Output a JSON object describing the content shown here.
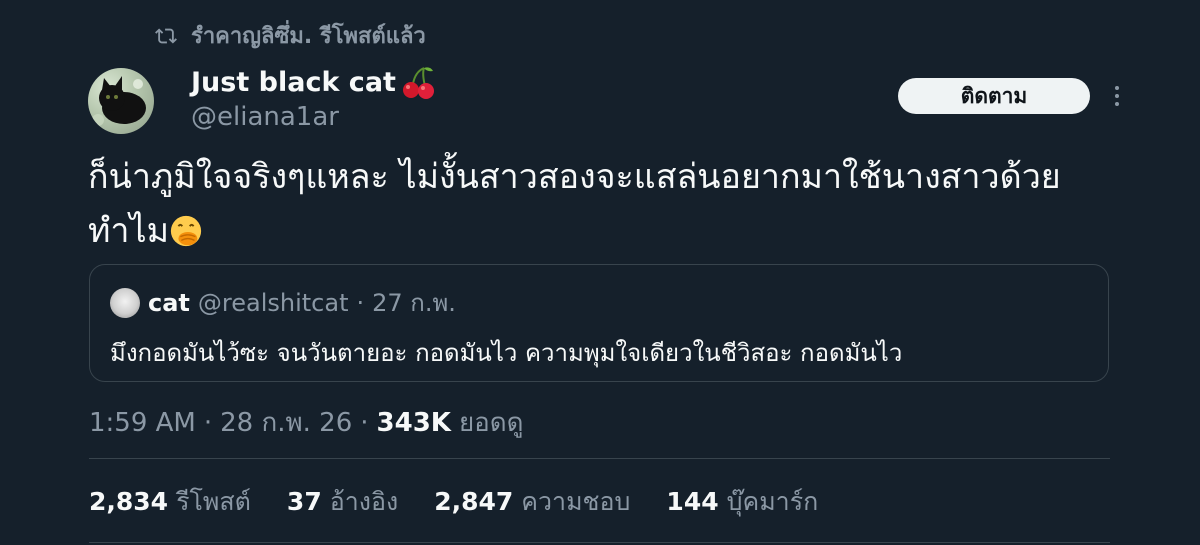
{
  "repost_header": {
    "text": "รำคาญลิซึ่ม. รีโพสต์แล้ว",
    "icon": "repost-icon"
  },
  "author": {
    "name": "Just black cat",
    "name_emoji": "cherry-icon",
    "handle": "@eliana1ar",
    "avatar": "black-cat-avatar"
  },
  "follow_label": "ติดตาม",
  "more_icon": "more-options-icon",
  "tweet": {
    "text": "ก็น่าภูมิใจจริงๆแหละ ไม่งั้นสาวสองจะแสล่นอยากมาใช้นางสาวด้วยทำไม",
    "emoji": "hand-over-mouth-emoji"
  },
  "quote": {
    "name": "cat",
    "handle": "@realshitcat",
    "separator": "·",
    "date": "27 ก.พ.",
    "text": "มึงกอดมันไว้ซะ จนวันตายอะ กอดมันไว ความพุมใจเดียวในชีวิสอะ กอดมันไว"
  },
  "meta": {
    "time": "1:59 AM",
    "sep1": "·",
    "date": "28 ก.พ. 26",
    "sep2": "·",
    "views_count": "343K",
    "views_label": "ยอดดู"
  },
  "stats": [
    {
      "count": "2,834",
      "label": "รีโพสต์"
    },
    {
      "count": "37",
      "label": "อ้างอิง"
    },
    {
      "count": "2,847",
      "label": "ความชอบ"
    },
    {
      "count": "144",
      "label": "บุ๊คมาร์ก"
    }
  ],
  "colors": {
    "background": "#15202b",
    "text_primary": "#f7f9f9",
    "text_secondary": "#8b98a5",
    "border": "#38444d",
    "button_bg": "#eff3f4"
  }
}
